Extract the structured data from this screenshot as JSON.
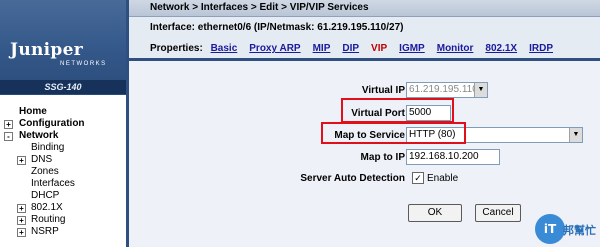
{
  "sidebar": {
    "logo": "Juniper",
    "logo_sub": "NETWORKS",
    "model": "SSG-140",
    "items": [
      {
        "label": "Home",
        "level": "top",
        "toggle": ""
      },
      {
        "label": "Configuration",
        "level": "top",
        "toggle": "+"
      },
      {
        "label": "Network",
        "level": "top",
        "toggle": "-"
      },
      {
        "label": "Binding",
        "level": "sub",
        "toggle": ""
      },
      {
        "label": "DNS",
        "level": "sub",
        "toggle": "+"
      },
      {
        "label": "Zones",
        "level": "sub",
        "toggle": ""
      },
      {
        "label": "Interfaces",
        "level": "sub",
        "toggle": ""
      },
      {
        "label": "DHCP",
        "level": "sub",
        "toggle": ""
      },
      {
        "label": "802.1X",
        "level": "sub",
        "toggle": "+"
      },
      {
        "label": "Routing",
        "level": "sub",
        "toggle": "+"
      },
      {
        "label": "NSRP",
        "level": "sub",
        "toggle": "+"
      }
    ]
  },
  "header": {
    "breadcrumb": "Network > Interfaces > Edit > VIP/VIP Services",
    "interface_line": "Interface: ethernet0/6 (IP/Netmask: 61.219.195.110/27)",
    "properties_label": "Properties:",
    "tabs": [
      "Basic",
      "Proxy ARP",
      "MIP",
      "DIP",
      "VIP",
      "IGMP",
      "Monitor",
      "802.1X",
      "IRDP"
    ],
    "active_tab": "VIP"
  },
  "form": {
    "virtual_ip_label": "Virtual IP",
    "virtual_ip_value": "61.219.195.110",
    "virtual_port_label": "Virtual Port",
    "virtual_port_value": "5000",
    "map_service_label": "Map to Service",
    "map_service_value": "HTTP (80)",
    "map_ip_label": "Map to IP",
    "map_ip_value": "192.168.10.200",
    "sad_label": "Server Auto Detection",
    "enable_label": "Enable",
    "enable_checked": "✓",
    "ok_label": "OK",
    "cancel_label": "Cancel"
  },
  "watermark": {
    "badge": "iT",
    "text": "邦幫忙"
  },
  "colors": {
    "highlight": "#e0101a",
    "sidebar_blue": "#335788",
    "link": "#1a1a9c",
    "active_tab": "#c00000"
  }
}
